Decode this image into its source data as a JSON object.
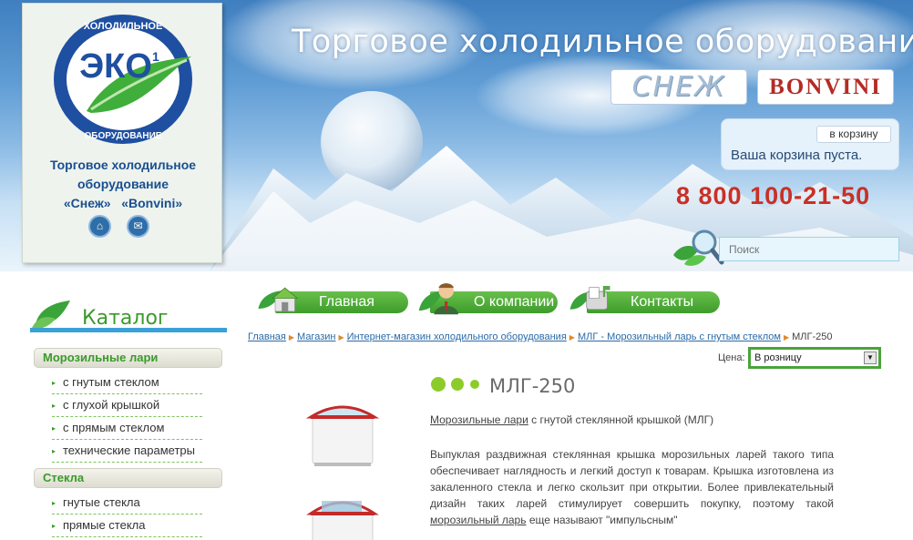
{
  "logo": {
    "emblem_top": "ХОЛОДИЛЬНОЕ",
    "emblem_main": "ЭКО",
    "emblem_sup": "1",
    "emblem_bottom": "ОБОРУДОВАНИЕ",
    "line1": "Торговое холодильное",
    "line2": "оборудование",
    "line3": "«Снеж»   «Bonvini»"
  },
  "header": {
    "title": "Торговое холодильное оборудование",
    "brand1": "СНЕЖ",
    "brand2": "BONVINI",
    "phone": "8 800 100-21-50"
  },
  "cart": {
    "button": "в корзину",
    "status": "Ваша корзина пуста."
  },
  "search": {
    "placeholder": "Поиск"
  },
  "nav": [
    {
      "label": "Главная"
    },
    {
      "label": "О компании"
    },
    {
      "label": "Контакты"
    }
  ],
  "catalog": {
    "title": "Каталог",
    "groups": [
      {
        "label": "Морозильные лари",
        "items": [
          "с гнутым стеклом",
          "с глухой крышкой",
          "с прямым стеклом",
          "технические параметры"
        ]
      },
      {
        "label": "Стекла",
        "items": [
          "гнутые стекла",
          "прямые стекла"
        ]
      }
    ]
  },
  "breadcrumb": {
    "items": [
      "Главная",
      "Магазин",
      "Интернет-магазин холодильного оборудования",
      "МЛГ - Морозильный ларь с гнутым стеклом"
    ],
    "current": "МЛГ-250"
  },
  "price": {
    "label": "Цена:",
    "selected": "В розницу"
  },
  "product": {
    "title": "МЛГ-250",
    "subtitle_link": "Морозильные лари",
    "subtitle_rest": " с гнутой стеклянной крышкой (МЛГ)",
    "desc_main": "Выпуклая раздвижная стеклянная крышка морозильных ларей такого типа обеспечивает наглядность и легкий доступ к товарам. Крышка изготовлена из закаленного стекла и легко скользит при открытии. Более привлекательный дизайн таких ларей стимулирует совершить покупку, поэтому такой ",
    "desc_link": "морозильный ларь",
    "desc_end": " еще называют \"импульсным\""
  }
}
